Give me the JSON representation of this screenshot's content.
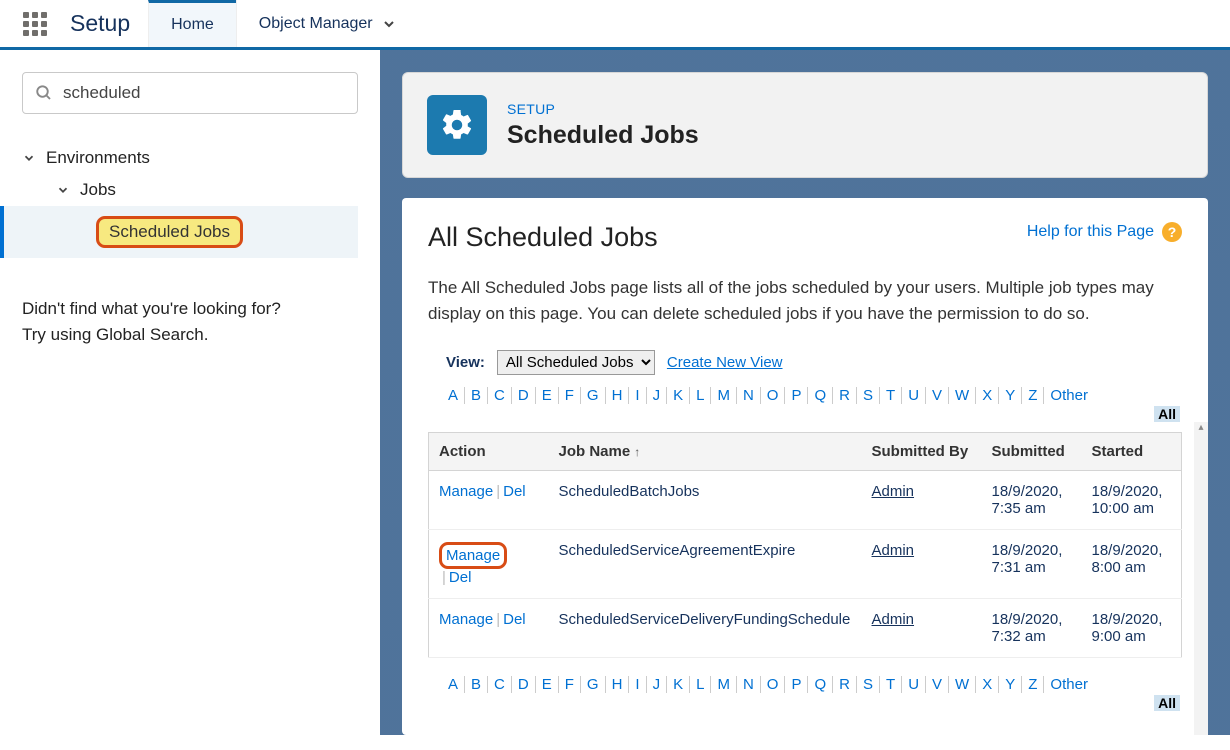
{
  "nav": {
    "app_title": "Setup",
    "tabs": [
      {
        "label": "Home",
        "active": true
      },
      {
        "label": "Object Manager",
        "active": false
      }
    ]
  },
  "sidebar": {
    "search_value": "scheduled",
    "tree": {
      "environments_label": "Environments",
      "jobs_label": "Jobs",
      "scheduled_jobs_label": "Scheduled Jobs"
    },
    "not_found_line1": "Didn't find what you're looking for?",
    "not_found_line2": "Try using Global Search."
  },
  "header_panel": {
    "eyebrow": "SETUP",
    "title": "Scheduled Jobs"
  },
  "content": {
    "help_link": "Help for this Page",
    "page_title": "All Scheduled Jobs",
    "description": "The All Scheduled Jobs page lists all of the jobs scheduled by your users. Multiple job types may display on this page. You can delete scheduled jobs if you have the permission to do so.",
    "view_label": "View:",
    "view_options": [
      "All Scheduled Jobs"
    ],
    "view_selected": "All Scheduled Jobs",
    "create_view_label": "Create New View",
    "alpha": [
      "A",
      "B",
      "C",
      "D",
      "E",
      "F",
      "G",
      "H",
      "I",
      "J",
      "K",
      "L",
      "M",
      "N",
      "O",
      "P",
      "Q",
      "R",
      "S",
      "T",
      "U",
      "V",
      "W",
      "X",
      "Y",
      "Z"
    ],
    "alpha_other": "Other",
    "alpha_all": "All",
    "columns": {
      "action": "Action",
      "job_name": "Job Name",
      "submitted_by": "Submitted By",
      "submitted": "Submitted",
      "started": "Started"
    },
    "actions": {
      "manage": "Manage",
      "del": "Del"
    },
    "rows": [
      {
        "job_name": "ScheduledBatchJobs",
        "submitted_by": "Admin",
        "submitted": "18/9/2020, 7:35 am",
        "started": "18/9/2020, 10:00 am",
        "highlight_manage": false
      },
      {
        "job_name": "ScheduledServiceAgreementExpire",
        "submitted_by": "Admin",
        "submitted": "18/9/2020, 7:31 am",
        "started": "18/9/2020, 8:00 am",
        "highlight_manage": true
      },
      {
        "job_name": "ScheduledServiceDeliveryFundingSchedule",
        "submitted_by": "Admin",
        "submitted": "18/9/2020, 7:32 am",
        "started": "18/9/2020, 9:00 am",
        "highlight_manage": false
      }
    ]
  }
}
